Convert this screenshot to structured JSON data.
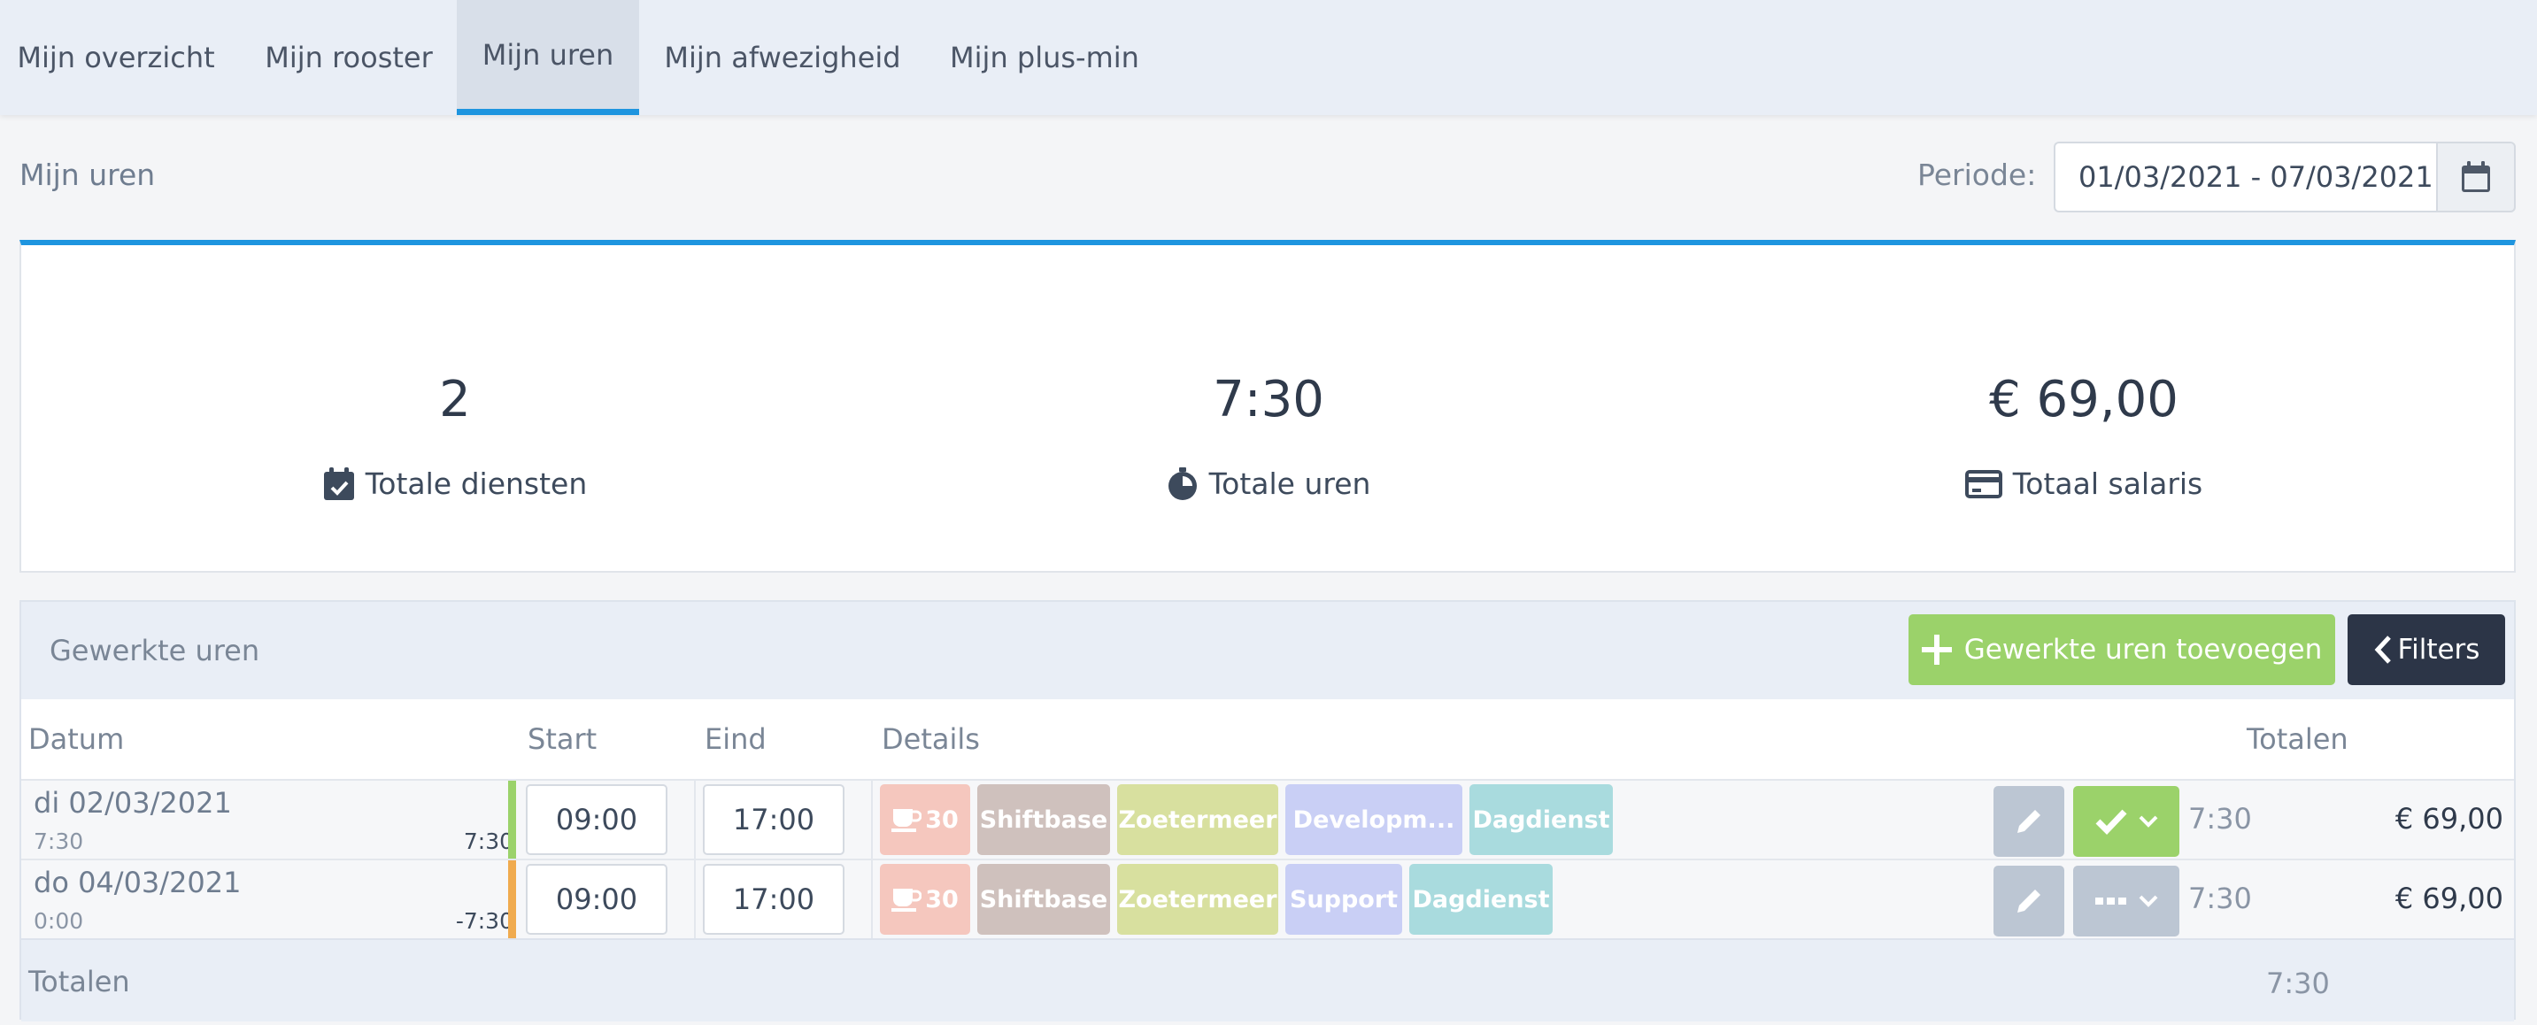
{
  "nav": {
    "tabs": [
      {
        "label": "Mijn overzicht"
      },
      {
        "label": "Mijn rooster"
      },
      {
        "label": "Mijn uren"
      },
      {
        "label": "Mijn afwezigheid"
      },
      {
        "label": "Mijn plus-min"
      }
    ],
    "active_tab": "Mijn uren"
  },
  "header": {
    "title": "Mijn uren",
    "periode_label": "Periode:",
    "periode_value": "01/03/2021 - 07/03/2021"
  },
  "stats": {
    "diensten": {
      "value": "2",
      "label": "Totale diensten"
    },
    "uren": {
      "value": "7:30",
      "label": "Totale uren"
    },
    "salaris": {
      "value": "€ 69,00",
      "label": "Totaal salaris"
    }
  },
  "panel": {
    "title": "Gewerkte uren",
    "add_label": "Gewerkte uren toevoegen",
    "filters_label": "Filters",
    "columns": {
      "datum": "Datum",
      "start": "Start",
      "eind": "Eind",
      "details": "Details",
      "totalen": "Totalen"
    },
    "rows": [
      {
        "date": "di 02/03/2021",
        "worked": "7:30",
        "balance": "7:30",
        "start": "09:00",
        "end": "17:00",
        "break": "30",
        "tags": [
          "Shiftbase",
          "Zoetermeer",
          "Developm...",
          "Dagdienst"
        ],
        "total": "7:30",
        "wage": "€ 69,00",
        "status": "approved"
      },
      {
        "date": "do 04/03/2021",
        "worked": "0:00",
        "balance": "-7:30",
        "start": "09:00",
        "end": "17:00",
        "break": "30",
        "tags": [
          "Shiftbase",
          "Zoetermeer",
          "Support",
          "Dagdienst"
        ],
        "total": "7:30",
        "wage": "€ 69,00",
        "status": "pending"
      }
    ],
    "totals_label": "Totalen",
    "totals_value": "7:30"
  },
  "colors": {
    "accent": "#1e95df",
    "approved_bar": "#9bd26a",
    "pending_bar": "#f0ab4f",
    "tag_break": "#f5c7be",
    "tag_shiftbase": "#cfc1bd",
    "tag_location": "#d8e09f",
    "tag_department": "#c9cff5",
    "tag_shift": "#a9dbde"
  },
  "icons": {
    "calendar": "calendar-icon",
    "calendar_check": "calendar-check-icon",
    "stopwatch": "stopwatch-icon",
    "credit_card": "credit-card-icon",
    "plus": "plus-icon",
    "chevron_left": "chevron-left-icon",
    "coffee": "coffee-icon",
    "pencil": "pencil-icon",
    "check": "check-icon",
    "ellipsis": "ellipsis-icon",
    "chevron_down": "chevron-down-icon"
  }
}
